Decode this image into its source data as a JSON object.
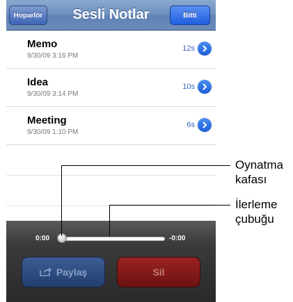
{
  "navbar": {
    "left_button": "Hoparlör",
    "title": "Sesli Notlar",
    "right_button": "Bitti"
  },
  "memos": [
    {
      "title": "Memo",
      "date": "9/30/09 3:16 PM",
      "duration": "12s"
    },
    {
      "title": "Idea",
      "date": "9/30/09 3:14 PM",
      "duration": "10s"
    },
    {
      "title": "Meeting",
      "date": "9/30/09 1:10 PM",
      "duration": "6s"
    }
  ],
  "player": {
    "elapsed": "0:00",
    "remaining": "-0:00",
    "progress": 0,
    "share_button": "Paylaş",
    "delete_button": "Sil"
  },
  "callouts": {
    "playhead_line1": "Oynatma",
    "playhead_line2": "kafası",
    "scrubber_line1": "İlerleme",
    "scrubber_line2": "çubuğu"
  },
  "colors": {
    "nav_bar": "#6d8fbd",
    "link_blue": "#3a64c2",
    "share_button": "#2e4c80",
    "delete_button": "#8a1b1b"
  },
  "icons": [
    "disclosure-icon",
    "share-icon"
  ]
}
